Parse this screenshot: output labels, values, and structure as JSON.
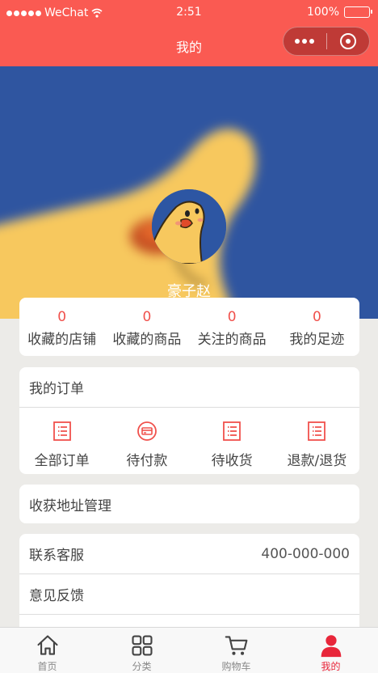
{
  "status_bar": {
    "carrier": "WeChat",
    "time": "2:51",
    "battery": "100%"
  },
  "nav": {
    "title": "我的"
  },
  "profile": {
    "username": "豪子赵"
  },
  "stats": [
    {
      "count": "0",
      "label": "收藏的店铺"
    },
    {
      "count": "0",
      "label": "收藏的商品"
    },
    {
      "count": "0",
      "label": "关注的商品"
    },
    {
      "count": "0",
      "label": "我的足迹"
    }
  ],
  "orders": {
    "title": "我的订单",
    "items": [
      {
        "label": "全部订单",
        "icon": "list-icon"
      },
      {
        "label": "待付款",
        "icon": "payment-icon"
      },
      {
        "label": "待收货",
        "icon": "list-icon"
      },
      {
        "label": "退款/退货",
        "icon": "list-icon"
      }
    ]
  },
  "address": {
    "label": "收获地址管理"
  },
  "service": {
    "contact_label": "联系客服",
    "contact_value": "400-000-000",
    "feedback_label": "意见反馈"
  },
  "tabs": [
    {
      "label": "首页",
      "icon": "home-icon"
    },
    {
      "label": "分类",
      "icon": "category-icon"
    },
    {
      "label": "购物车",
      "icon": "cart-icon"
    },
    {
      "label": "我的",
      "icon": "user-icon"
    }
  ],
  "colors": {
    "brand": "#fa5a52",
    "accent": "#f0514c",
    "active_tab": "#e8263a"
  }
}
